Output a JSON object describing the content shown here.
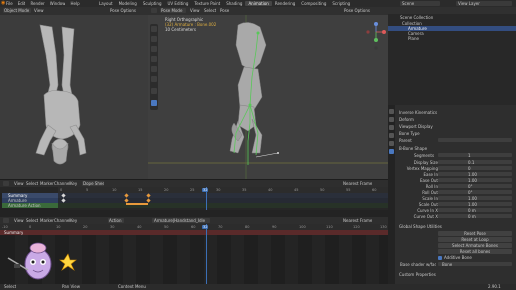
{
  "menu": [
    "File",
    "Edit",
    "Render",
    "Window",
    "Help"
  ],
  "workspace_tabs": [
    "Layout",
    "Modeling",
    "Sculpting",
    "UV Editing",
    "Texture Paint",
    "Shading",
    "Animation",
    "Rendering",
    "Compositing",
    "Scripting"
  ],
  "active_tab": "Animation",
  "scene": "Scene",
  "view_layer": "View Layer",
  "left_view": {
    "mode": "Object Mode",
    "menus": [
      "View"
    ],
    "options": "Pose Options"
  },
  "main_view": {
    "mode": "Pose Mode",
    "menus": [
      "View",
      "Select",
      "Pose"
    ],
    "options": "Pose Options",
    "overlay_title": "Right Orthographic",
    "overlay_line2": "(32) Armature : Bone.002",
    "overlay_line3": "10 Centimeters"
  },
  "outliner": {
    "title": "Scene Collection",
    "items": [
      "Collection",
      "Armature",
      "Camera",
      "Plane"
    ]
  },
  "properties": {
    "section1": "Inverse Kinematics",
    "section2": "Deform",
    "section3": "Viewport Display",
    "section4": "Bone Type",
    "section5": "Parent",
    "section6": "B-Bone Shape",
    "segments_label": "Segments",
    "segments_value": "1",
    "bbone_rows": [
      "Display Size",
      "Vertex Mapping",
      "Ease In",
      "Ease Out",
      "Roll In",
      "Roll Out",
      "Scale In",
      "Scale Out",
      "Curve In X",
      "Curve Out X"
    ],
    "bbone_values": [
      "0.1",
      "0",
      "1.00",
      "1.00",
      "0°",
      "0°",
      "1.00",
      "1.00",
      "0 m",
      "0 m"
    ],
    "section7": "Global Shape Utilities",
    "btn_reset": "Reset Pose",
    "btn_rest": "Reset at Loop",
    "btn_copy": "Select Armature Bones",
    "btn_select": "Reset all bones",
    "checkbox_label": "Additive Bone",
    "base_label": "Base shader w/fade",
    "base_value": "Bone",
    "footer": "Custom Properties"
  },
  "timeline": {
    "menus": [
      "View",
      "Select",
      "Marker",
      "Channel",
      "Key"
    ],
    "mode": "Dope Sheet",
    "search": "Summary",
    "ruler": [
      "0",
      "5",
      "10",
      "15",
      "20",
      "25",
      "30",
      "35",
      "40",
      "45",
      "50",
      "55",
      "60"
    ],
    "channels": [
      "Summary",
      "Armature",
      "Armature Action"
    ],
    "playhead": "32",
    "right": "Nearest Frame"
  },
  "nla": {
    "menus": [
      "View",
      "Select",
      "Marker",
      "Channel",
      "Key"
    ],
    "mode": "Action",
    "action_name": "Armature|Handstand_Idle",
    "ruler": [
      "-10",
      "0",
      "10",
      "20",
      "30",
      "40",
      "50",
      "60",
      "70",
      "80",
      "90",
      "100",
      "110",
      "120",
      "130"
    ],
    "playhead": "32",
    "channel": "Summary",
    "right": "Nearest Frame"
  },
  "status": {
    "left": "Select",
    "middle": "Pan View",
    "right": "Context Menu",
    "version": "2.90.1"
  },
  "colors": {
    "accent": "#3b6fb6",
    "bone_green": "#58c858",
    "key_orange": "#e89a3c"
  }
}
